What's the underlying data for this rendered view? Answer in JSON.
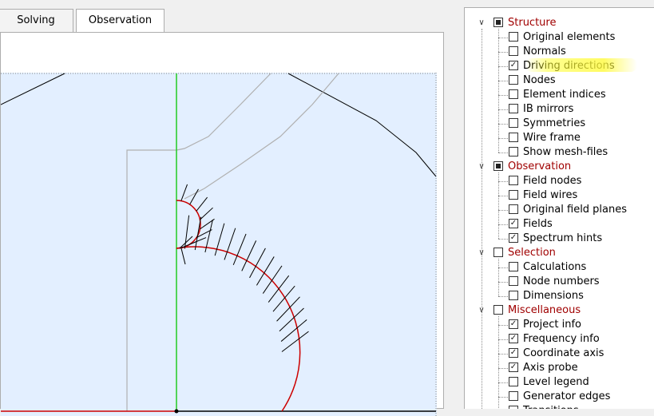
{
  "tabs": [
    {
      "label": "Solving"
    },
    {
      "label": "Observation"
    }
  ],
  "tree": {
    "groups": [
      {
        "label": "Structure",
        "state": "partial",
        "expanded": true,
        "items": [
          {
            "label": "Original elements",
            "checked": false
          },
          {
            "label": "Normals",
            "checked": false
          },
          {
            "label": "Driving directions",
            "checked": true
          },
          {
            "label": "Nodes",
            "checked": false
          },
          {
            "label": "Element indices",
            "checked": false
          },
          {
            "label": "IB mirrors",
            "checked": false
          },
          {
            "label": "Symmetries",
            "checked": false
          },
          {
            "label": "Wire frame",
            "checked": false
          },
          {
            "label": "Show mesh-files",
            "checked": false
          }
        ]
      },
      {
        "label": "Observation",
        "state": "partial",
        "expanded": true,
        "items": [
          {
            "label": "Field nodes",
            "checked": false
          },
          {
            "label": "Field wires",
            "checked": false
          },
          {
            "label": "Original field planes",
            "checked": false
          },
          {
            "label": "Fields",
            "checked": true
          },
          {
            "label": "Spectrum hints",
            "checked": true
          }
        ]
      },
      {
        "label": "Selection",
        "state": "unchecked",
        "expanded": true,
        "items": [
          {
            "label": "Calculations",
            "checked": false
          },
          {
            "label": "Node numbers",
            "checked": false
          },
          {
            "label": "Dimensions",
            "checked": false
          }
        ]
      },
      {
        "label": "Miscellaneous",
        "state": "unchecked",
        "expanded": true,
        "items": [
          {
            "label": "Project info",
            "checked": true
          },
          {
            "label": "Frequency info",
            "checked": true
          },
          {
            "label": "Coordinate axis",
            "checked": true
          },
          {
            "label": "Axis probe",
            "checked": true
          },
          {
            "label": "Level legend",
            "checked": false
          },
          {
            "label": "Generator edges",
            "checked": false
          },
          {
            "label": "Transitions",
            "checked": false
          }
        ]
      }
    ]
  },
  "colors": {
    "viewport_bg": "#e3efff",
    "boundary": "#cc0000",
    "axis": "#22cc22",
    "category_text": "#a00000",
    "highlight": "#ffff33"
  }
}
